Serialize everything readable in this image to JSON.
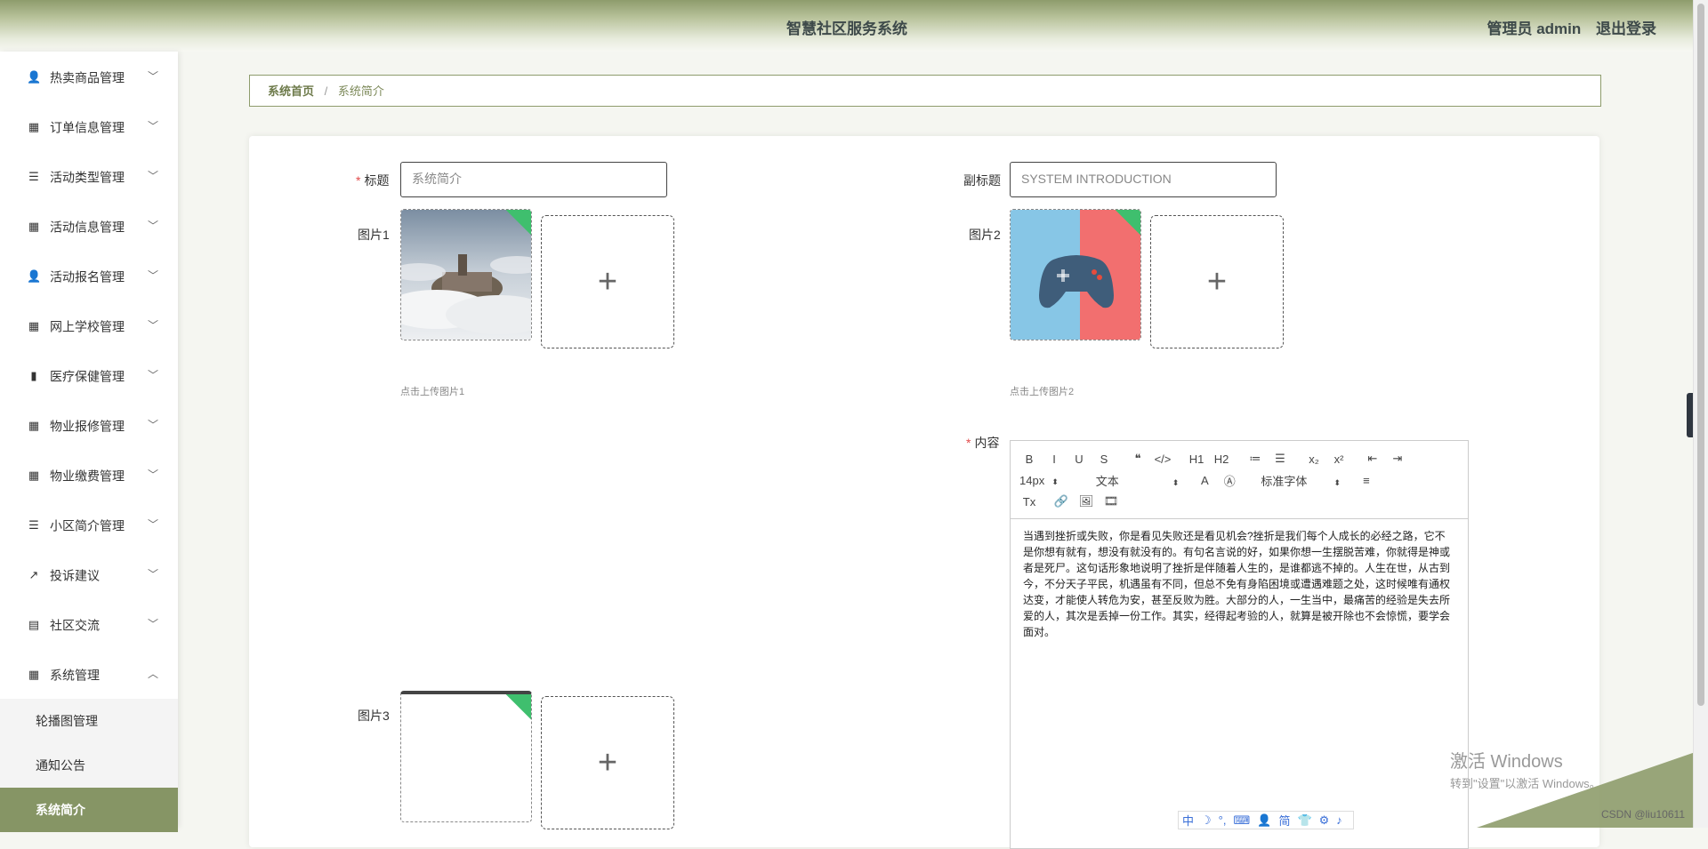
{
  "header": {
    "title": "智慧社区服务系统",
    "user": "管理员 admin",
    "logout": "退出登录"
  },
  "sidebar": {
    "items": [
      {
        "label": "热卖商品管理",
        "icon": "user-icon",
        "glyph": "👤"
      },
      {
        "label": "订单信息管理",
        "icon": "grid-icon",
        "glyph": "▦"
      },
      {
        "label": "活动类型管理",
        "icon": "sliders-icon",
        "glyph": "☰"
      },
      {
        "label": "活动信息管理",
        "icon": "grid-icon",
        "glyph": "▦"
      },
      {
        "label": "活动报名管理",
        "icon": "user-icon",
        "glyph": "👤"
      },
      {
        "label": "网上学校管理",
        "icon": "grid-icon",
        "glyph": "▦"
      },
      {
        "label": "医疗保健管理",
        "icon": "bar-chart-icon",
        "glyph": "▮"
      },
      {
        "label": "物业报修管理",
        "icon": "grid-icon",
        "glyph": "▦"
      },
      {
        "label": "物业缴费管理",
        "icon": "grid-icon",
        "glyph": "▦"
      },
      {
        "label": "小区简介管理",
        "icon": "list-icon",
        "glyph": "☰"
      },
      {
        "label": "投诉建议",
        "icon": "trend-icon",
        "glyph": "↗"
      },
      {
        "label": "社区交流",
        "icon": "clipboard-icon",
        "glyph": "▤"
      },
      {
        "label": "系统管理",
        "icon": "apps-icon",
        "glyph": "▦"
      }
    ],
    "submenu": [
      {
        "label": "轮播图管理"
      },
      {
        "label": "通知公告"
      },
      {
        "label": "系统简介"
      }
    ]
  },
  "breadcrumb": {
    "home": "系统首页",
    "sep": "/",
    "current": "系统简介"
  },
  "form": {
    "title_label": "标题",
    "title_value": "系统简介",
    "subtitle_label": "副标题",
    "subtitle_value": "SYSTEM INTRODUCTION",
    "pic1_label": "图片1",
    "pic1_hint": "点击上传图片1",
    "pic2_label": "图片2",
    "pic2_hint": "点击上传图片2",
    "pic3_label": "图片3",
    "content_label": "内容",
    "plus": "+"
  },
  "editor": {
    "buttons_row1": [
      "B",
      "I",
      "U",
      "S",
      "❝",
      "</>",
      "H1",
      "H2",
      "≔",
      "☰",
      "x₂",
      "x²",
      "⇤",
      "⇥"
    ],
    "font_size": "14px",
    "block_type": "文本",
    "font_family": "标准字体",
    "buttons_row3": [
      "Tx",
      "🔗",
      "🖼",
      "🎞"
    ],
    "content": "当遇到挫折或失败，你是看见失败还是看见机会?挫折是我们每个人成长的必经之路，它不是你想有就有，想没有就没有的。有句名言说的好，如果你想一生摆脱苦难，你就得是神或者是死尸。这句话形象地说明了挫折是伴随着人生的，是谁都逃不掉的。人生在世，从古到今，不分天子平民，机遇虽有不同，但总不免有身陷困境或遭遇难题之处，这时候唯有通权达变，才能使人转危为安，甚至反败为胜。大部分的人，一生当中，最痛苦的经验是失去所爱的人，其次是丢掉一份工作。其实，经得起考验的人，就算是被开除也不会惊慌，要学会面对。"
  },
  "watermark": {
    "line1": "激活 Windows",
    "line2": "转到\"设置\"以激活 Windows。"
  },
  "csdn": "CSDN @liu10611",
  "ime": [
    "中",
    "☽",
    "°,",
    "⌨",
    "👤",
    "简",
    "👕",
    "⚙",
    "♪"
  ],
  "colors": {
    "accent": "#869565",
    "header": "#8e9c6c",
    "required": "#e24b4b"
  }
}
